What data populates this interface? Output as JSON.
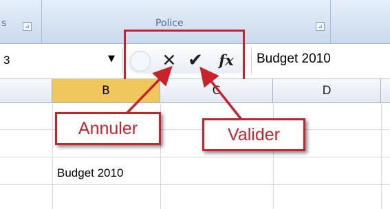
{
  "ribbon": {
    "group_label_partial": "s",
    "police_label": "Police",
    "launcher_glyph": "⊿"
  },
  "formula_bar": {
    "name_box_value": "3",
    "dropdown_glyph": "▼",
    "cancel_glyph": "✕",
    "enter_glyph": "✔",
    "fx_label": "fx",
    "formula_value": "Budget 2010"
  },
  "columns": [
    "B",
    "C",
    "D"
  ],
  "cells": {
    "b5": "Budget 2010"
  },
  "callouts": {
    "annuler": "Annuler",
    "valider": "Valider"
  },
  "colors": {
    "annotation_red": "#c8222a",
    "active_column": "#f0c75d",
    "ribbon_blue": "#d6e3f3"
  },
  "icons": {
    "launcher": "dialog-launcher-icon",
    "dropdown": "chevron-down-icon",
    "cancel": "close-icon",
    "enter": "checkmark-icon",
    "function": "function-icon"
  }
}
